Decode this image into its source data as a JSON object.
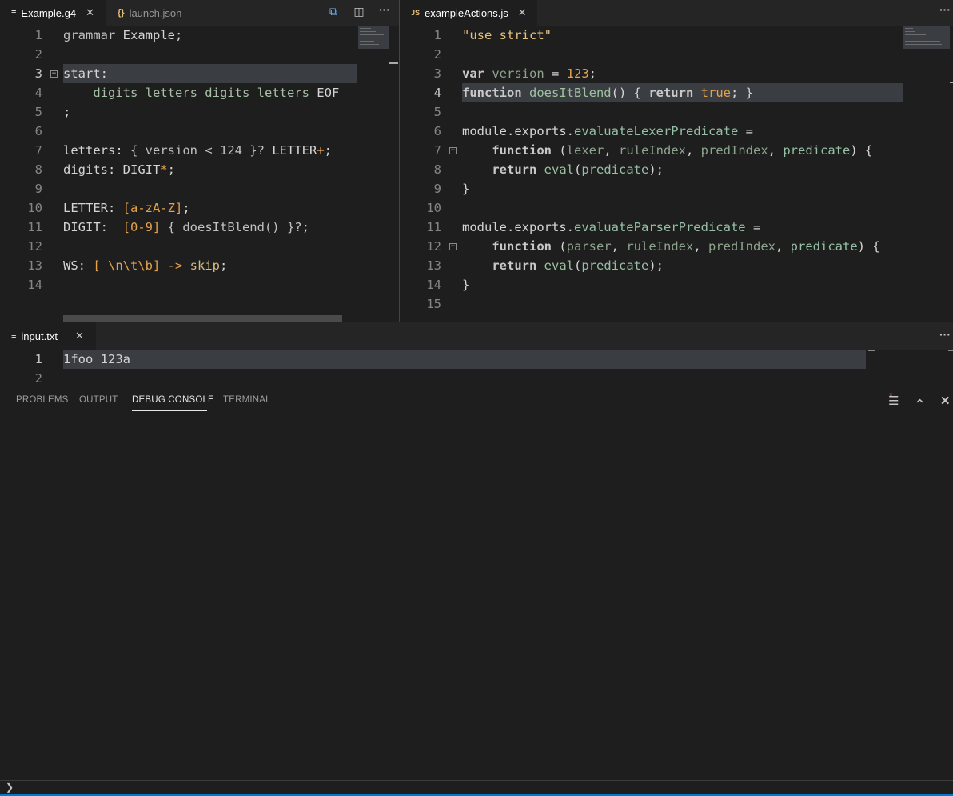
{
  "left_editor": {
    "tabs": [
      {
        "label": "Example.g4",
        "icon": "≡",
        "active": true,
        "close": "✕"
      },
      {
        "label": "launch.json",
        "icon": "{}",
        "active": false
      }
    ],
    "lines": [
      {
        "n": "1",
        "tokens": [
          {
            "t": "grammar",
            "c": "kwg"
          },
          {
            "t": " Example;",
            "c": "txt"
          }
        ]
      },
      {
        "n": "2",
        "tokens": []
      },
      {
        "n": "3",
        "tokens": [
          {
            "t": "start:",
            "c": "txt"
          }
        ]
      },
      {
        "n": "4",
        "tokens": [
          {
            "t": "    digits letters digits letters ",
            "c": "rule"
          },
          {
            "t": "EOF",
            "c": "txt"
          }
        ]
      },
      {
        "n": "5",
        "tokens": [
          {
            "t": ";",
            "c": "txt"
          }
        ]
      },
      {
        "n": "6",
        "tokens": []
      },
      {
        "n": "7",
        "tokens": [
          {
            "t": "letters: ",
            "c": "txt"
          },
          {
            "t": "{ version < 124 }?",
            "c": "kwg"
          },
          {
            "t": " LETTER",
            "c": "txt"
          },
          {
            "t": "+",
            "c": "opr"
          },
          {
            "t": ";",
            "c": "txt"
          }
        ]
      },
      {
        "n": "8",
        "tokens": [
          {
            "t": "digits: DIGIT",
            "c": "txt"
          },
          {
            "t": "*",
            "c": "opr"
          },
          {
            "t": ";",
            "c": "txt"
          }
        ]
      },
      {
        "n": "9",
        "tokens": []
      },
      {
        "n": "10",
        "tokens": [
          {
            "t": "LETTER: ",
            "c": "txt"
          },
          {
            "t": "[a-zA-Z]",
            "c": "opr"
          },
          {
            "t": ";",
            "c": "txt"
          }
        ]
      },
      {
        "n": "11",
        "tokens": [
          {
            "t": "DIGIT:  ",
            "c": "txt"
          },
          {
            "t": "[0-9]",
            "c": "opr"
          },
          {
            "t": " { doesItBlend() }?",
            "c": "kwg"
          },
          {
            "t": ";",
            "c": "txt"
          }
        ]
      },
      {
        "n": "12",
        "tokens": []
      },
      {
        "n": "13",
        "tokens": [
          {
            "t": "WS: ",
            "c": "txt"
          },
          {
            "t": "[ \\n\\t\\b]",
            "c": "opr"
          },
          {
            "t": " -> ",
            "c": "opr"
          },
          {
            "t": "skip",
            "c": "ws"
          },
          {
            "t": ";",
            "c": "txt"
          }
        ]
      },
      {
        "n": "14",
        "tokens": []
      }
    ],
    "current_line": 3
  },
  "right_editor": {
    "tabs": [
      {
        "label": "exampleActions.js",
        "icon": "JS",
        "active": true,
        "close": "✕"
      }
    ],
    "lines": [
      {
        "n": "1",
        "tokens": [
          {
            "t": "\"use strict\"",
            "c": "str"
          }
        ]
      },
      {
        "n": "2",
        "tokens": []
      },
      {
        "n": "3",
        "tokens": [
          {
            "t": "var",
            "c": "kw"
          },
          {
            "t": " version",
            "c": "var"
          },
          {
            "t": " = ",
            "c": "txt"
          },
          {
            "t": "123",
            "c": "num"
          },
          {
            "t": ";",
            "c": "txt"
          }
        ]
      },
      {
        "n": "4",
        "tokens": [
          {
            "t": "function",
            "c": "kw"
          },
          {
            "t": " doesItBlend",
            "c": "fn"
          },
          {
            "t": "() { ",
            "c": "txt"
          },
          {
            "t": "return",
            "c": "kw"
          },
          {
            "t": " ",
            "c": "txt"
          },
          {
            "t": "true",
            "c": "num"
          },
          {
            "t": "; }",
            "c": "txt"
          }
        ]
      },
      {
        "n": "5",
        "tokens": []
      },
      {
        "n": "6",
        "tokens": [
          {
            "t": "module.exports.",
            "c": "txt"
          },
          {
            "t": "evaluateLexerPredicate",
            "c": "prop"
          },
          {
            "t": " =",
            "c": "txt"
          }
        ]
      },
      {
        "n": "7",
        "tokens": [
          {
            "t": "    ",
            "c": "txt"
          },
          {
            "t": "function",
            "c": "kw"
          },
          {
            "t": " (",
            "c": "txt"
          },
          {
            "t": "lexer",
            "c": "var"
          },
          {
            "t": ", ",
            "c": "txt"
          },
          {
            "t": "ruleIndex",
            "c": "var"
          },
          {
            "t": ", ",
            "c": "txt"
          },
          {
            "t": "predIndex",
            "c": "var"
          },
          {
            "t": ", ",
            "c": "txt"
          },
          {
            "t": "predicate",
            "c": "prop"
          },
          {
            "t": ") {",
            "c": "txt"
          }
        ]
      },
      {
        "n": "8",
        "tokens": [
          {
            "t": "    ",
            "c": "txt"
          },
          {
            "t": "return",
            "c": "kw"
          },
          {
            "t": " ",
            "c": "txt"
          },
          {
            "t": "eval",
            "c": "fn"
          },
          {
            "t": "(",
            "c": "txt"
          },
          {
            "t": "predicate",
            "c": "prop"
          },
          {
            "t": ");",
            "c": "txt"
          }
        ]
      },
      {
        "n": "9",
        "tokens": [
          {
            "t": "}",
            "c": "txt"
          }
        ]
      },
      {
        "n": "10",
        "tokens": []
      },
      {
        "n": "11",
        "tokens": [
          {
            "t": "module.exports.",
            "c": "txt"
          },
          {
            "t": "evaluateParserPredicate",
            "c": "prop"
          },
          {
            "t": " =",
            "c": "txt"
          }
        ]
      },
      {
        "n": "12",
        "tokens": [
          {
            "t": "    ",
            "c": "txt"
          },
          {
            "t": "function",
            "c": "kw"
          },
          {
            "t": " (",
            "c": "txt"
          },
          {
            "t": "parser",
            "c": "var"
          },
          {
            "t": ", ",
            "c": "txt"
          },
          {
            "t": "ruleIndex",
            "c": "var"
          },
          {
            "t": ", ",
            "c": "txt"
          },
          {
            "t": "predIndex",
            "c": "var"
          },
          {
            "t": ", ",
            "c": "txt"
          },
          {
            "t": "predicate",
            "c": "prop"
          },
          {
            "t": ") {",
            "c": "txt"
          }
        ]
      },
      {
        "n": "13",
        "tokens": [
          {
            "t": "    ",
            "c": "txt"
          },
          {
            "t": "return",
            "c": "kw"
          },
          {
            "t": " ",
            "c": "txt"
          },
          {
            "t": "eval",
            "c": "fn"
          },
          {
            "t": "(",
            "c": "txt"
          },
          {
            "t": "predicate",
            "c": "prop"
          },
          {
            "t": ");",
            "c": "txt"
          }
        ]
      },
      {
        "n": "14",
        "tokens": [
          {
            "t": "}",
            "c": "txt"
          }
        ]
      },
      {
        "n": "15",
        "tokens": []
      }
    ],
    "current_line": 4
  },
  "bottom_editor": {
    "tabs": [
      {
        "label": "input.txt",
        "icon": "≡",
        "active": true,
        "close": "✕"
      }
    ],
    "lines": [
      {
        "n": "1",
        "tokens": [
          {
            "t": "1foo 123a",
            "c": "txt"
          }
        ]
      },
      {
        "n": "2",
        "tokens": []
      }
    ],
    "current_line": 1
  },
  "panel": {
    "tabs": [
      "PROBLEMS",
      "OUTPUT",
      "DEBUG CONSOLE",
      "TERMINAL"
    ],
    "active_tab": "DEBUG CONSOLE",
    "prompt": "❯"
  },
  "icons": {
    "more": "···",
    "split": "◫",
    "open_changes": "⧉",
    "clear_console": "☰",
    "maximize": "⌃",
    "close_panel": "✕",
    "fold": "−"
  }
}
